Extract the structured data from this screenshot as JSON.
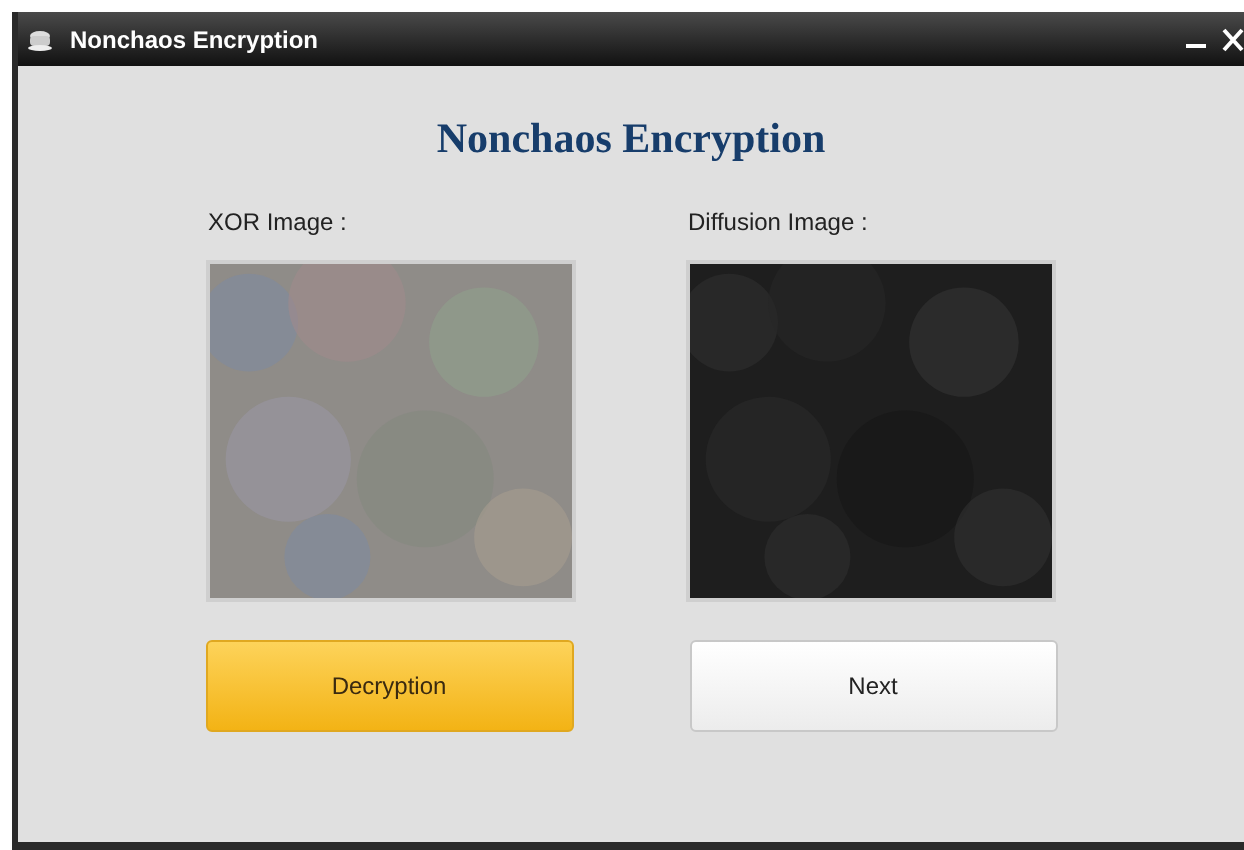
{
  "window": {
    "title": "Nonchaos Encryption"
  },
  "heading": "Nonchaos Encryption",
  "panels": [
    {
      "label": "XOR Image :",
      "kind": "picture"
    },
    {
      "label": "Diffusion Image :",
      "kind": "picture"
    }
  ],
  "buttons": [
    {
      "label": "Decryption",
      "kind": "primary"
    },
    {
      "label": "Next",
      "kind": "default"
    }
  ]
}
